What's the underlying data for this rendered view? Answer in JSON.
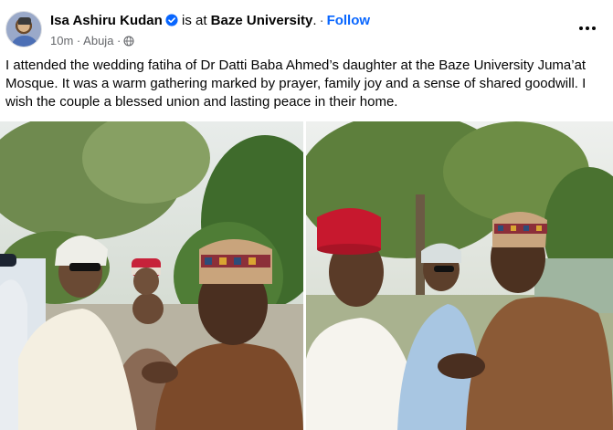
{
  "post": {
    "author_name": "Isa Ashiru Kudan",
    "is_at_text": "is at",
    "place": "Baze University",
    "place_suffix": ".",
    "separator": "·",
    "follow_label": "Follow",
    "time": "10m",
    "meta_separator": "·",
    "location": "Abuja",
    "body": "I attended the wedding fatiha of Dr Datti Baba Ahmed’s daughter at the Baze University Juma’at Mosque. It was a warm gathering marked by prayer, family joy and a sense of shared goodwill. I wish the couple a blessed union and lasting peace in their home."
  },
  "icons": {
    "verified": "verified-badge-icon",
    "audience": "globe-icon",
    "more": "more-options-icon"
  },
  "colors": {
    "link_blue": "#0866ff",
    "secondary_text": "#65676b",
    "verified_blue": "#0866ff"
  },
  "photos": [
    {
      "id": "photo-left",
      "alt": ""
    },
    {
      "id": "photo-right",
      "alt": ""
    }
  ]
}
